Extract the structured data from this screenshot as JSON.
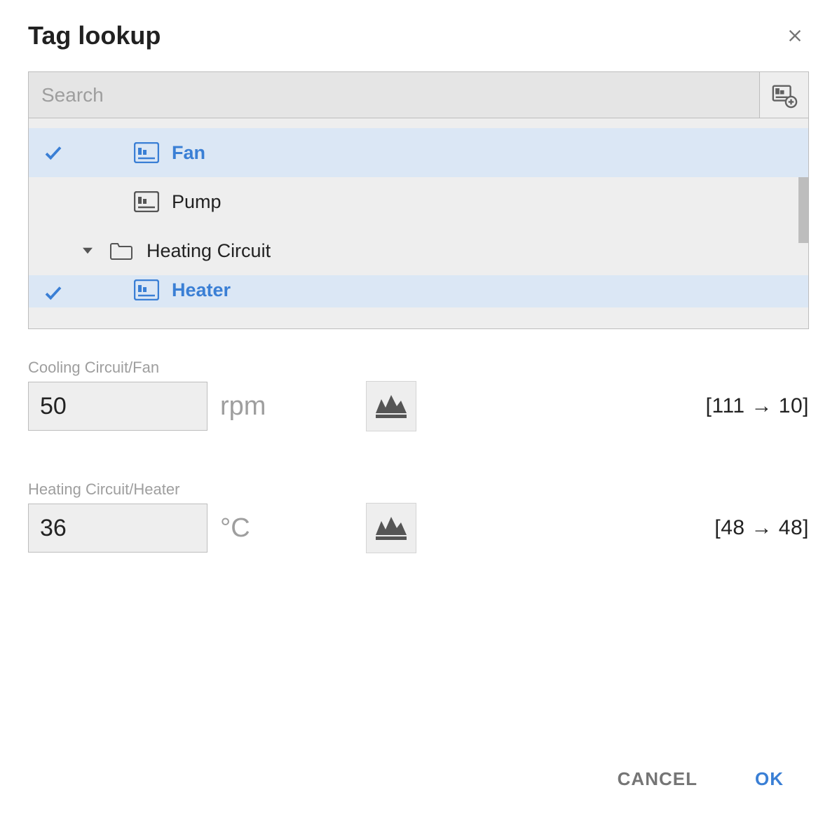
{
  "dialog": {
    "title": "Tag lookup"
  },
  "search": {
    "placeholder": "Search",
    "value": ""
  },
  "tree": {
    "rows": [
      {
        "label": "Fan",
        "type": "tag",
        "selected": true,
        "level": 1
      },
      {
        "label": "Pump",
        "type": "tag",
        "selected": false,
        "level": 1
      },
      {
        "label": "Heating Circuit",
        "type": "folder",
        "expanded": true,
        "level": 0
      },
      {
        "label": "Heater",
        "type": "tag",
        "selected": true,
        "level": 1,
        "partial": true
      }
    ]
  },
  "values": [
    {
      "path": "Cooling Circuit/Fan",
      "value": "50",
      "unit": "rpm",
      "range_from": "111",
      "range_to": "10"
    },
    {
      "path": "Heating Circuit/Heater",
      "value": "36",
      "unit": "°C",
      "range_from": "48",
      "range_to": "48"
    }
  ],
  "buttons": {
    "cancel": "CANCEL",
    "ok": "OK"
  }
}
